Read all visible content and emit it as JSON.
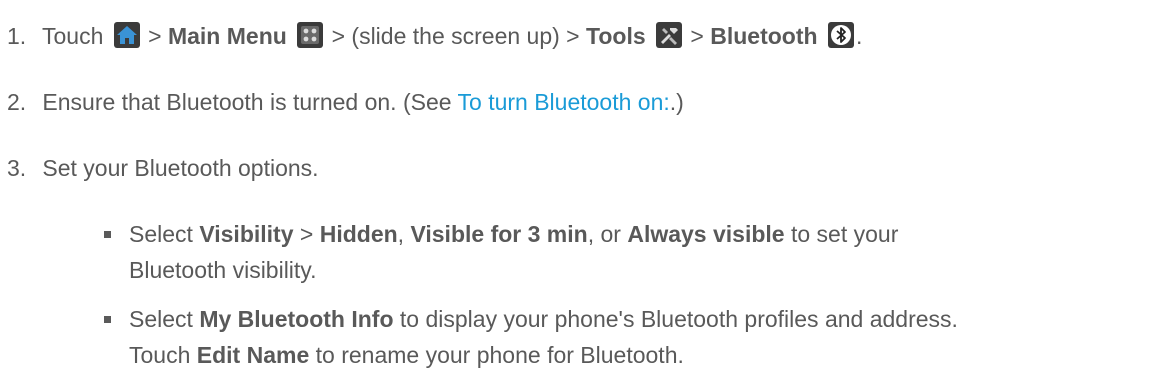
{
  "steps": [
    {
      "number": "1.",
      "parts": {
        "touch": "Touch",
        "sep1": ">",
        "main_menu": "Main Menu",
        "sep2": "> (slide the screen up) >",
        "tools": "Tools",
        "sep3": ">",
        "bluetooth": "Bluetooth",
        "end": "."
      },
      "icons": [
        "home-icon",
        "main-menu-icon",
        "tools-icon",
        "bluetooth-icon"
      ]
    },
    {
      "number": "2.",
      "text_before": "Ensure that Bluetooth is turned on. (See ",
      "link": "To turn Bluetooth on:",
      "text_after": ".)"
    },
    {
      "number": "3.",
      "text": "Set your Bluetooth options."
    }
  ],
  "bullets": [
    {
      "line1": {
        "t1": "Select ",
        "b1": "Visibility",
        "t2": " > ",
        "b2": "Hidden",
        "t3": ", ",
        "b3": "Visible for 3 min",
        "t4": ", or ",
        "b4": "Always visible",
        "t5": " to set your"
      },
      "line2": "Bluetooth visibility."
    },
    {
      "line1": {
        "t1": "Select ",
        "b1": "My Bluetooth Info",
        "t2": " to display your phone's Bluetooth profiles and address."
      },
      "line2": {
        "t1": "Touch ",
        "b1": "Edit Name",
        "t2": " to rename your phone for Bluetooth."
      }
    }
  ],
  "colors": {
    "text": "#595959",
    "link": "#1a9bd7",
    "icon_bg": "#3b3b3b",
    "home_icon": "#3a93d6"
  }
}
